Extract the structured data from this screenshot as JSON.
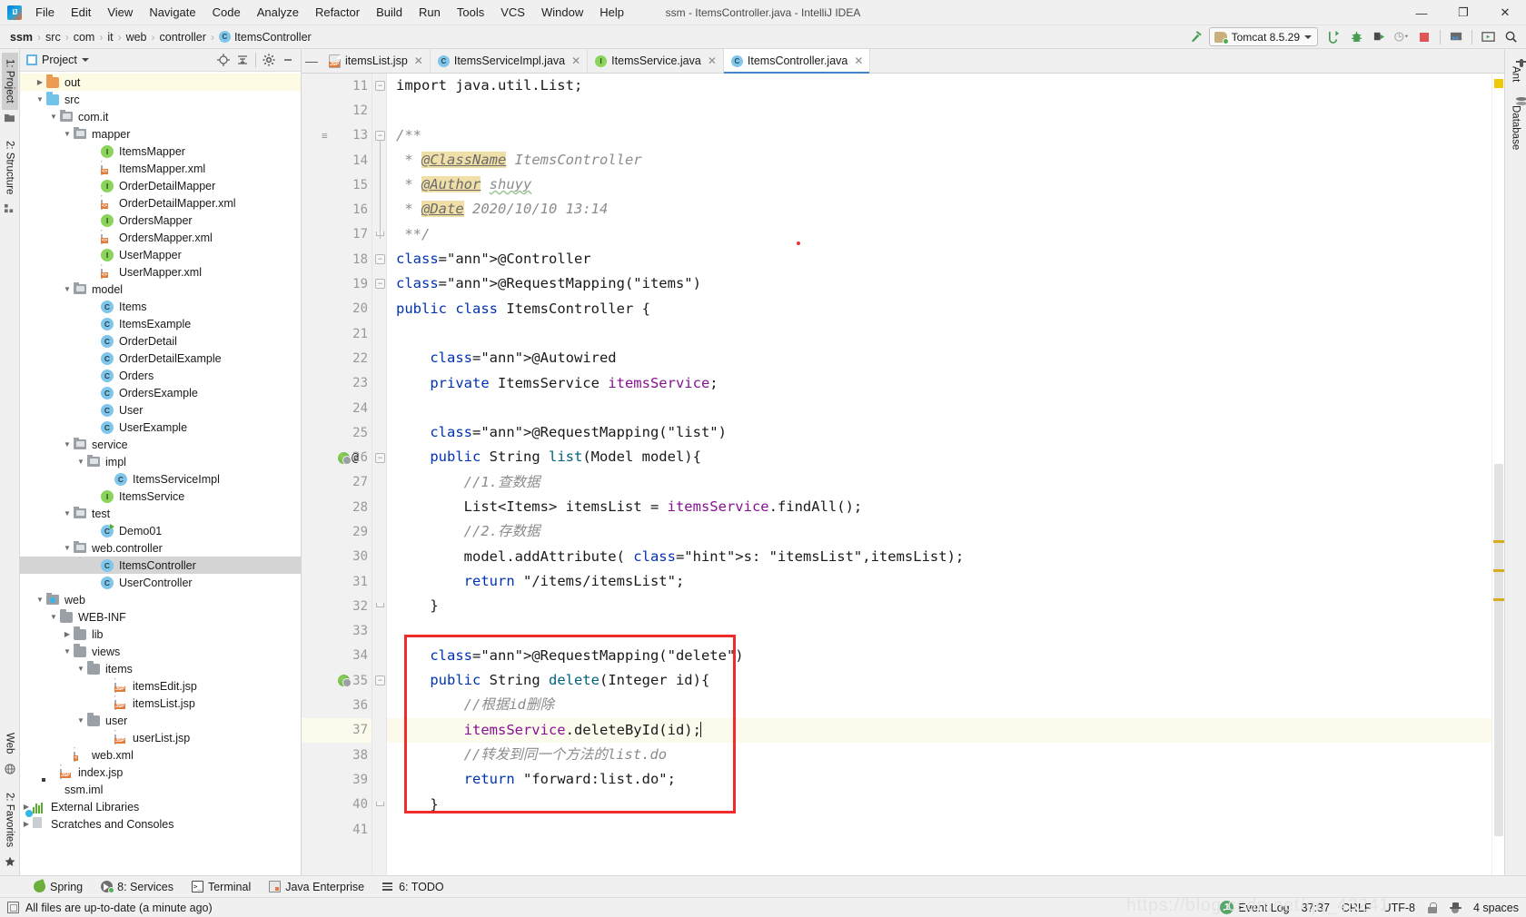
{
  "titlebar": {
    "window_title": "ssm - ItemsController.java - IntelliJ IDEA",
    "menus": [
      "File",
      "Edit",
      "View",
      "Navigate",
      "Code",
      "Analyze",
      "Refactor",
      "Build",
      "Run",
      "Tools",
      "VCS",
      "Window",
      "Help"
    ],
    "controls": {
      "minimize": "—",
      "maximize": "❐",
      "close": "✕"
    }
  },
  "navbar": {
    "breadcrumbs": [
      "ssm",
      "src",
      "com",
      "it",
      "web",
      "controller",
      "ItemsController"
    ],
    "separator": "›",
    "run_config": "Tomcat 8.5.29",
    "buttons": {
      "build": "build-hammer",
      "run": "run",
      "debug": "debug",
      "run_coverage": "run-with-coverage",
      "profile": "profile",
      "stop": "stop",
      "project_structure": "project-structure",
      "update": "update-application",
      "search_everywhere": "search-everywhere"
    }
  },
  "left_rail": {
    "tabs": [
      {
        "label": "1: Project",
        "active": true
      },
      {
        "label": "2: Structure",
        "active": false
      }
    ],
    "bottom_tabs": [
      {
        "label": "Web"
      },
      {
        "label": "2: Favorites"
      }
    ]
  },
  "right_rail": {
    "tabs": [
      "Ant",
      "Database"
    ]
  },
  "project": {
    "title": "Project",
    "tools": [
      "locate-icon",
      "collapse-all-icon",
      "settings-gear-icon",
      "hide-icon"
    ],
    "tree": [
      {
        "label": "out",
        "indent": 1,
        "icon": "folder-orange",
        "arrow": "collapsed",
        "state": "highlight"
      },
      {
        "label": "src",
        "indent": 1,
        "icon": "folder-blue",
        "arrow": "expanded"
      },
      {
        "label": "com.it",
        "indent": 2,
        "icon": "package",
        "arrow": "expanded"
      },
      {
        "label": "mapper",
        "indent": 3,
        "icon": "package",
        "arrow": "expanded"
      },
      {
        "label": "ItemsMapper",
        "indent": 5,
        "icon": "interface"
      },
      {
        "label": "ItemsMapper.xml",
        "indent": 5,
        "icon": "xml"
      },
      {
        "label": "OrderDetailMapper",
        "indent": 5,
        "icon": "interface"
      },
      {
        "label": "OrderDetailMapper.xml",
        "indent": 5,
        "icon": "xml"
      },
      {
        "label": "OrdersMapper",
        "indent": 5,
        "icon": "interface"
      },
      {
        "label": "OrdersMapper.xml",
        "indent": 5,
        "icon": "xml"
      },
      {
        "label": "UserMapper",
        "indent": 5,
        "icon": "interface"
      },
      {
        "label": "UserMapper.xml",
        "indent": 5,
        "icon": "xml"
      },
      {
        "label": "model",
        "indent": 3,
        "icon": "package",
        "arrow": "expanded"
      },
      {
        "label": "Items",
        "indent": 5,
        "icon": "class"
      },
      {
        "label": "ItemsExample",
        "indent": 5,
        "icon": "class"
      },
      {
        "label": "OrderDetail",
        "indent": 5,
        "icon": "class"
      },
      {
        "label": "OrderDetailExample",
        "indent": 5,
        "icon": "class"
      },
      {
        "label": "Orders",
        "indent": 5,
        "icon": "class"
      },
      {
        "label": "OrdersExample",
        "indent": 5,
        "icon": "class"
      },
      {
        "label": "User",
        "indent": 5,
        "icon": "class"
      },
      {
        "label": "UserExample",
        "indent": 5,
        "icon": "class"
      },
      {
        "label": "service",
        "indent": 3,
        "icon": "package",
        "arrow": "expanded"
      },
      {
        "label": "impl",
        "indent": 4,
        "icon": "package",
        "arrow": "expanded"
      },
      {
        "label": "ItemsServiceImpl",
        "indent": 6,
        "icon": "class"
      },
      {
        "label": "ItemsService",
        "indent": 5,
        "icon": "interface"
      },
      {
        "label": "test",
        "indent": 3,
        "icon": "package",
        "arrow": "expanded"
      },
      {
        "label": "Demo01",
        "indent": 5,
        "icon": "class-runnable"
      },
      {
        "label": "web.controller",
        "indent": 3,
        "icon": "package",
        "arrow": "expanded"
      },
      {
        "label": "ItemsController",
        "indent": 5,
        "icon": "class",
        "state": "selected"
      },
      {
        "label": "UserController",
        "indent": 5,
        "icon": "class"
      },
      {
        "label": "web",
        "indent": 1,
        "icon": "web-package",
        "arrow": "expanded"
      },
      {
        "label": "WEB-INF",
        "indent": 2,
        "icon": "folder-gray",
        "arrow": "expanded"
      },
      {
        "label": "lib",
        "indent": 3,
        "icon": "folder-gray",
        "arrow": "collapsed"
      },
      {
        "label": "views",
        "indent": 3,
        "icon": "folder-gray",
        "arrow": "expanded"
      },
      {
        "label": "items",
        "indent": 4,
        "icon": "folder-gray",
        "arrow": "expanded"
      },
      {
        "label": "itemsEdit.jsp",
        "indent": 6,
        "icon": "jsp"
      },
      {
        "label": "itemsList.jsp",
        "indent": 6,
        "icon": "jsp"
      },
      {
        "label": "user",
        "indent": 4,
        "icon": "folder-gray",
        "arrow": "expanded"
      },
      {
        "label": "userList.jsp",
        "indent": 6,
        "icon": "jsp"
      },
      {
        "label": "web.xml",
        "indent": 3,
        "icon": "xml-web"
      },
      {
        "label": "index.jsp",
        "indent": 2,
        "icon": "jsp"
      },
      {
        "label": "ssm.iml",
        "indent": 1,
        "icon": "iml"
      },
      {
        "label": "External Libraries",
        "indent": 0,
        "icon": "library",
        "arrow": "collapsed"
      },
      {
        "label": "Scratches and Consoles",
        "indent": 0,
        "icon": "scratches",
        "arrow": "collapsed"
      }
    ]
  },
  "editor": {
    "tabs": [
      {
        "label": "itemsList.jsp",
        "icon": "jsp",
        "active": false
      },
      {
        "label": "ItemsServiceImpl.java",
        "icon": "class",
        "active": false
      },
      {
        "label": "ItemsService.java",
        "icon": "interface",
        "active": false
      },
      {
        "label": "ItemsController.java",
        "icon": "class",
        "active": true
      }
    ],
    "first_line": 11,
    "last_line": 41,
    "current_line": 37,
    "lines": [
      {
        "n": 11,
        "code": "import java.util.List;"
      },
      {
        "n": 12,
        "code": ""
      },
      {
        "n": 13,
        "code": "/**"
      },
      {
        "n": 14,
        "code": " * @ClassName ItemsController"
      },
      {
        "n": 15,
        "code": " * @Author shuyy"
      },
      {
        "n": 16,
        "code": " * @Date 2020/10/10 13:14"
      },
      {
        "n": 17,
        "code": " **/"
      },
      {
        "n": 18,
        "code": "@Controller"
      },
      {
        "n": 19,
        "code": "@RequestMapping(\"items\")"
      },
      {
        "n": 20,
        "code": "public class ItemsController {"
      },
      {
        "n": 21,
        "code": ""
      },
      {
        "n": 22,
        "code": "    @Autowired"
      },
      {
        "n": 23,
        "code": "    private ItemsService itemsService;"
      },
      {
        "n": 24,
        "code": ""
      },
      {
        "n": 25,
        "code": "    @RequestMapping(\"list\")"
      },
      {
        "n": 26,
        "code": "    public String list(Model model){"
      },
      {
        "n": 27,
        "code": "        //1.查数据"
      },
      {
        "n": 28,
        "code": "        List<Items> itemsList = itemsService.findAll();"
      },
      {
        "n": 29,
        "code": "        //2.存数据"
      },
      {
        "n": 30,
        "code": "        model.addAttribute( s: \"itemsList\",itemsList);"
      },
      {
        "n": 31,
        "code": "        return \"/items/itemsList\";"
      },
      {
        "n": 32,
        "code": "    }"
      },
      {
        "n": 33,
        "code": ""
      },
      {
        "n": 34,
        "code": "    @RequestMapping(\"delete\")"
      },
      {
        "n": 35,
        "code": "    public String delete(Integer id){"
      },
      {
        "n": 36,
        "code": "        //根据id删除"
      },
      {
        "n": 37,
        "code": "        itemsService.deleteById(id);"
      },
      {
        "n": 38,
        "code": "        //转发到同一个方法的list.do"
      },
      {
        "n": 39,
        "code": "        return \"forward:list.do\";"
      },
      {
        "n": 40,
        "code": "    }"
      },
      {
        "n": 41,
        "code": ""
      }
    ],
    "gutter_icons": [
      {
        "line": 26,
        "icon": "spring-mvc-mapping-icon",
        "extra": "@"
      },
      {
        "line": 35,
        "icon": "spring-mvc-mapping-icon"
      }
    ],
    "param_hint": "s:",
    "annotation": {
      "type": "red-rectangle",
      "covers_lines": "34-40"
    }
  },
  "toolwindows": {
    "items": [
      {
        "label": "Spring",
        "icon": "spring-leaf-icon"
      },
      {
        "label": "8: Services",
        "icon": "services-icon"
      },
      {
        "label": "Terminal",
        "icon": "terminal-icon"
      },
      {
        "label": "Java Enterprise",
        "icon": "java-enterprise-icon"
      },
      {
        "label": "6: TODO",
        "icon": "todo-icon"
      }
    ]
  },
  "statusbar": {
    "message": "All files are up-to-date (a minute ago)",
    "event_log": "Event Log",
    "event_count": "1",
    "caret_position": "37:37",
    "line_separator": "CRLF",
    "encoding": "UTF-8",
    "indent": "4 spaces",
    "watermark": "https://blog.csdn.net/qq_43241"
  }
}
